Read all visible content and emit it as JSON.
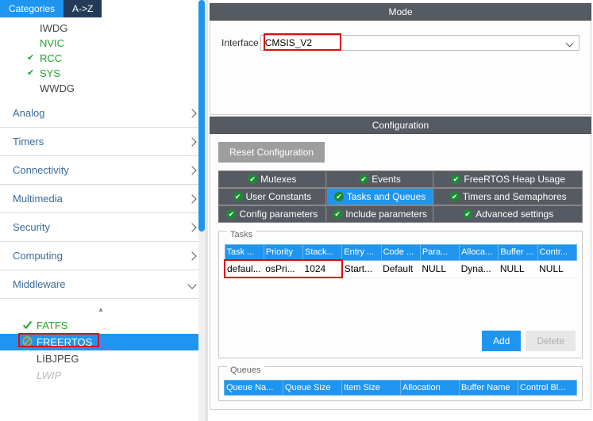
{
  "tabs": {
    "categories": "Categories",
    "az": "A->Z"
  },
  "tree": {
    "iwdg": "IWDG",
    "nvic": "NVIC",
    "rcc": "RCC",
    "sys": "SYS",
    "wwdg": "WWDG"
  },
  "sections": {
    "analog": "Analog",
    "timers": "Timers",
    "connectivity": "Connectivity",
    "multimedia": "Multimedia",
    "security": "Security",
    "computing": "Computing",
    "middleware": "Middleware"
  },
  "middleware": {
    "fatfs": "FATFS",
    "freertos": "FREERTOS",
    "libjpeg": "LIBJPEG",
    "lwip": "LWIP"
  },
  "mode": {
    "header": "Mode",
    "label": "Interface",
    "value": "CMSIS_V2"
  },
  "config": {
    "header": "Configuration",
    "reset": "Reset Configuration",
    "tabs": {
      "mutexes": "Mutexes",
      "events": "Events",
      "heap": "FreeRTOS Heap Usage",
      "userconst": "User Constants",
      "tasksqueues": "Tasks and Queues",
      "timers": "Timers and Semaphores",
      "configparams": "Config parameters",
      "includeparams": "Include parameters",
      "advanced": "Advanced settings"
    },
    "tasks": {
      "legend": "Tasks",
      "headers": {
        "name": "Task ...",
        "priority": "Priority",
        "stack": "Stack...",
        "entry": "Entry ...",
        "code": "Code ...",
        "param": "Para...",
        "alloc": "Alloca...",
        "buffer": "Buffer ...",
        "control": "Contr..."
      },
      "rows": [
        {
          "name": "defaul...",
          "priority": "osPri...",
          "stack": "1024",
          "entry": "Start...",
          "code": "Default",
          "param": "NULL",
          "alloc": "Dyna...",
          "buffer": "NULL",
          "control": "NULL"
        }
      ],
      "add": "Add",
      "delete": "Delete"
    },
    "queues": {
      "legend": "Queues",
      "headers": {
        "name": "Queue Na...",
        "size": "Queue Size",
        "item": "Item Size",
        "alloc": "Allocation",
        "buffer": "Buffer Name",
        "control": "Control Bl..."
      }
    }
  }
}
